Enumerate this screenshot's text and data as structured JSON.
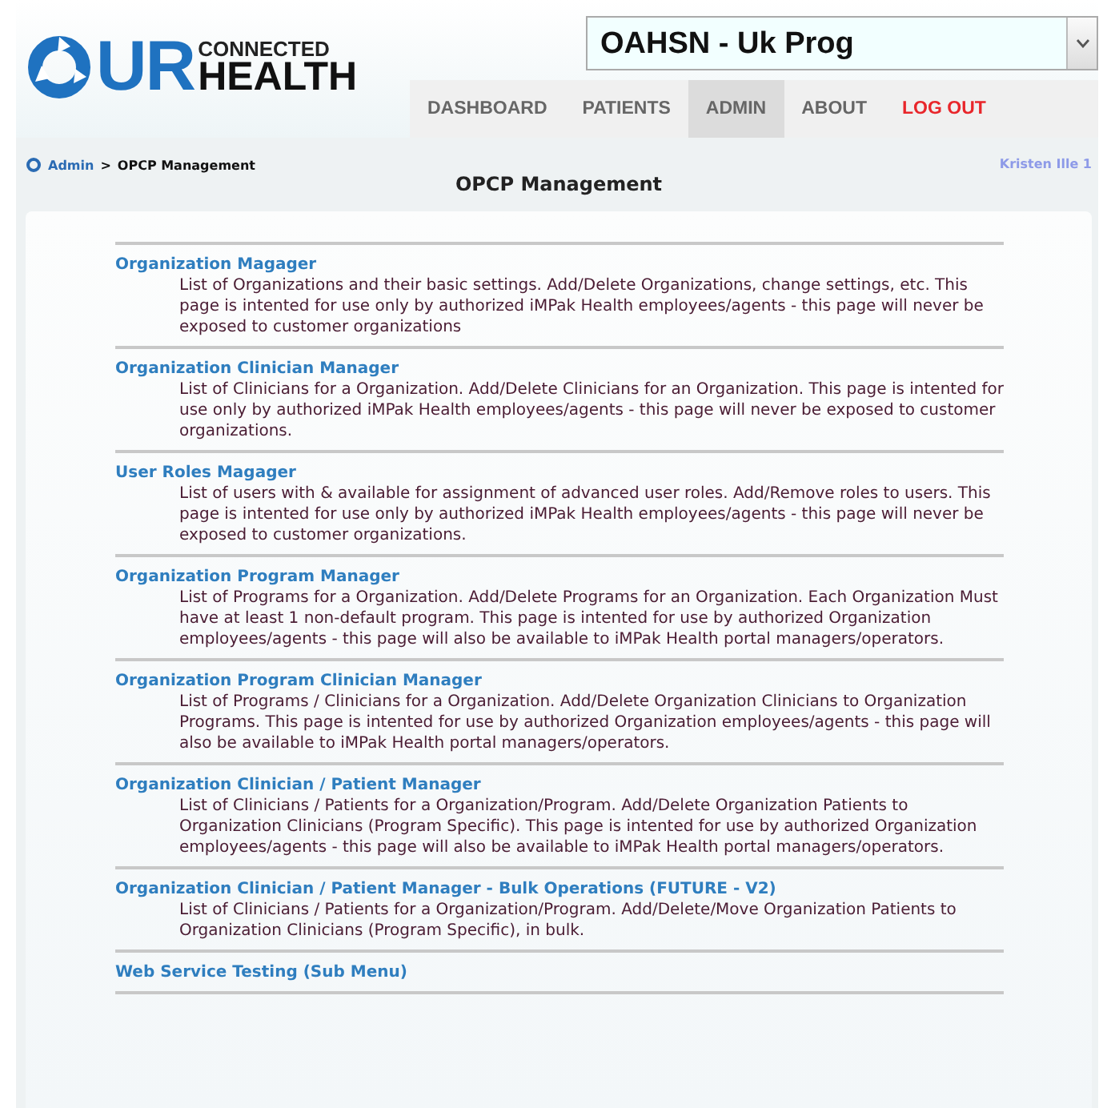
{
  "logo": {
    "letters": "UR",
    "top_word": "CONNECTED",
    "bottom_word": "HEALTH"
  },
  "program_select": {
    "value": "OAHSN - Uk Prog"
  },
  "nav": [
    {
      "label": "DASHBOARD",
      "selected": false,
      "kind": "link"
    },
    {
      "label": "PATIENTS",
      "selected": false,
      "kind": "link"
    },
    {
      "label": "ADMIN",
      "selected": true,
      "kind": "link"
    },
    {
      "label": "ABOUT",
      "selected": false,
      "kind": "link"
    },
    {
      "label": "LOG OUT",
      "selected": false,
      "kind": "logout"
    }
  ],
  "breadcrumb": {
    "parent": "Admin",
    "separator": ">",
    "current": "OPCP Management"
  },
  "user": "Kristen Ille 1",
  "page_title": "OPCP Management",
  "items": [
    {
      "title": "Organization Magager",
      "description": "List of Organizations and their basic settings. Add/Delete Organizations, change settings, etc. This page is intented for use only by authorized iMPak Health employees/agents - this page will never be exposed to customer organizations"
    },
    {
      "title": "Organization Clinician Manager",
      "description": "List of Clinicians for a Organization. Add/Delete Clinicians for an Organization. This page is intented for use only by authorized iMPak Health employees/agents - this page will never be exposed to customer organizations."
    },
    {
      "title": "User Roles Magager",
      "description": "List of users with & available for assignment of advanced user roles. Add/Remove roles to users. This page is intented for use only by authorized iMPak Health employees/agents - this page will never be exposed to customer organizations."
    },
    {
      "title": "Organization Program Manager",
      "description": "List of Programs for a Organization. Add/Delete Programs for an Organization. Each Organization Must have at least 1 non-default program. This page is intented for use by authorized Organization employees/agents - this page will also be available to iMPak Health portal managers/operators."
    },
    {
      "title": "Organization Program Clinician Manager",
      "description": "List of Programs / Clinicians for a Organization. Add/Delete Organization Clinicians to Organization Programs. This page is intented for use by authorized Organization employees/agents - this page will also be available to iMPak Health portal managers/operators."
    },
    {
      "title": "Organization Clinician / Patient Manager",
      "description": "List of Clinicians / Patients for a Organization/Program. Add/Delete Organization Patients to Organization Clinicians (Program Specific). This page is intented for use by authorized Organization employees/agents - this page will also be available to iMPak Health portal managers/operators."
    },
    {
      "title": "Organization Clinician / Patient Manager - Bulk Operations (FUTURE - V2)",
      "description": "List of Clinicians / Patients for a Organization/Program. Add/Delete/Move Organization Patients to Organization Clinicians (Program Specific), in bulk."
    },
    {
      "title": "Web Service Testing (Sub Menu)"
    }
  ]
}
